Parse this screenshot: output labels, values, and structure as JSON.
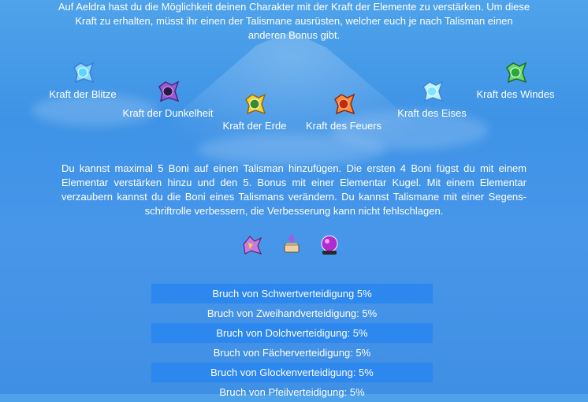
{
  "intro_text": "Auf Aeldra hast du die Möglichkeit deinen Charakter mit der Kraft der Elemente zu verstärken. Um diese Kraft zu erhalten, müsst ihr einen der Talismane ausrüsten, welcher euch je nach Talisman einen anderen Bonus gibt.",
  "talismans": [
    {
      "label": "Kraft der Blitze",
      "icon": "lightning-talisman-icon",
      "color": "#5ad8ff"
    },
    {
      "label": "Kraft der Dunkelheit",
      "icon": "darkness-talisman-icon",
      "color": "#b04cff"
    },
    {
      "label": "Kraft der Erde",
      "icon": "earth-talisman-icon",
      "color": "#d8d020"
    },
    {
      "label": "Kraft des Feuers",
      "icon": "fire-talisman-icon",
      "color": "#ff6a2a"
    },
    {
      "label": "Kraft des Eises",
      "icon": "ice-talisman-icon",
      "color": "#7fe6ff"
    },
    {
      "label": "Kraft des Windes",
      "icon": "wind-talisman-icon",
      "color": "#4ed04a"
    }
  ],
  "info_text": "Du kannst maximal 5 Boni auf einen Talisman hinzufügen. Die ersten 4 Boni fügst du mit einem Elementar verstärken hinzu und den 5. Bonus mit einer Elementar Kugel. Mit einem Elementar verzaubern kannst du die Boni eines Talismans verändern. Du kannst Talismane mit einer Segens-schriftrolle verbessern, die Verbesserung kann nicht fehlschlagen.",
  "items": [
    {
      "icon": "elemental-enhance-icon"
    },
    {
      "icon": "blessing-scroll-icon"
    },
    {
      "icon": "elemental-orb-icon"
    }
  ],
  "bonuses": [
    "Bruch von Schwertverteidigung 5%",
    "Bruch von Zweihandverteidigung: 5%",
    "Bruch von Dolchverteidigung: 5%",
    "Bruch von Fächerverteidigung: 5%",
    "Bruch von Glockenverteidigung: 5%",
    "Bruch von Pfeilverteidigung: 5%"
  ]
}
